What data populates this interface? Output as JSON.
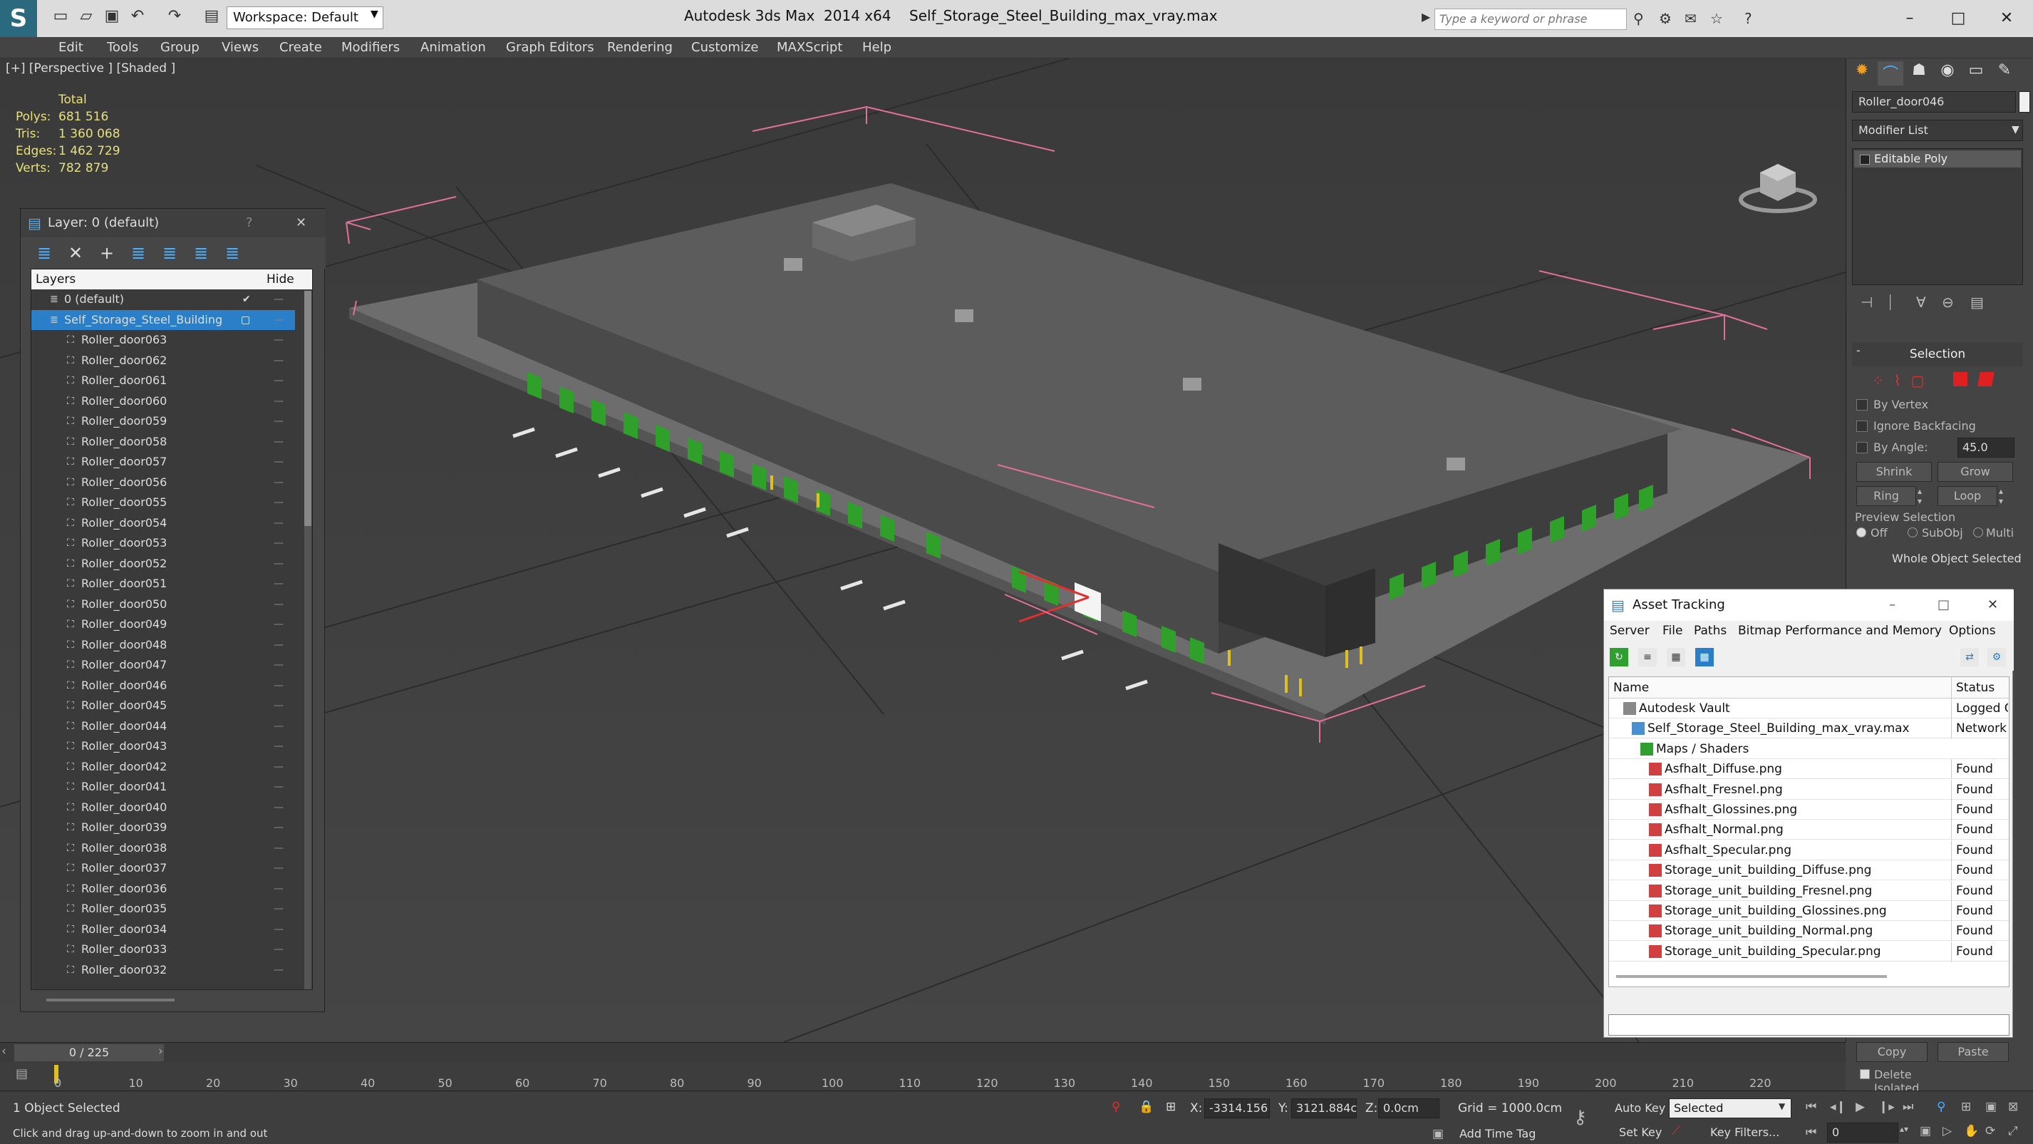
{
  "app": {
    "title": "Autodesk 3ds Max  2014 x64",
    "file": "Self_Storage_Steel_Building_max_vray.max",
    "workspace": "Workspace: Default",
    "search_placeholder": "Type a keyword or phrase"
  },
  "menu": [
    "Edit",
    "Tools",
    "Group",
    "Views",
    "Create",
    "Modifiers",
    "Animation",
    "Graph Editors",
    "Rendering",
    "Customize",
    "MAXScript",
    "Help"
  ],
  "viewport": {
    "label": "[+] [Perspective ] [Shaded ]",
    "stats": {
      "header": "Total",
      "polys_label": "Polys:",
      "polys": "681 516",
      "tris_label": "Tris:",
      "tris": "1 360 068",
      "edges_label": "Edges:",
      "edges": "1 462 729",
      "verts_label": "Verts:",
      "verts": "782 879"
    }
  },
  "layer_panel": {
    "title": "Layer: 0 (default)",
    "help": "?",
    "col_layers": "Layers",
    "col_hide": "Hide",
    "rows": [
      {
        "name": "0 (default)",
        "level": 0
      },
      {
        "name": "Self_Storage_Steel_Building",
        "level": 0,
        "selected": true
      },
      {
        "name": "Roller_door063",
        "level": 1
      },
      {
        "name": "Roller_door062",
        "level": 1
      },
      {
        "name": "Roller_door061",
        "level": 1
      },
      {
        "name": "Roller_door060",
        "level": 1
      },
      {
        "name": "Roller_door059",
        "level": 1
      },
      {
        "name": "Roller_door058",
        "level": 1
      },
      {
        "name": "Roller_door057",
        "level": 1
      },
      {
        "name": "Roller_door056",
        "level": 1
      },
      {
        "name": "Roller_door055",
        "level": 1
      },
      {
        "name": "Roller_door054",
        "level": 1
      },
      {
        "name": "Roller_door053",
        "level": 1
      },
      {
        "name": "Roller_door052",
        "level": 1
      },
      {
        "name": "Roller_door051",
        "level": 1
      },
      {
        "name": "Roller_door050",
        "level": 1
      },
      {
        "name": "Roller_door049",
        "level": 1
      },
      {
        "name": "Roller_door048",
        "level": 1
      },
      {
        "name": "Roller_door047",
        "level": 1
      },
      {
        "name": "Roller_door046",
        "level": 1
      },
      {
        "name": "Roller_door045",
        "level": 1
      },
      {
        "name": "Roller_door044",
        "level": 1
      },
      {
        "name": "Roller_door043",
        "level": 1
      },
      {
        "name": "Roller_door042",
        "level": 1
      },
      {
        "name": "Roller_door041",
        "level": 1
      },
      {
        "name": "Roller_door040",
        "level": 1
      },
      {
        "name": "Roller_door039",
        "level": 1
      },
      {
        "name": "Roller_door038",
        "level": 1
      },
      {
        "name": "Roller_door037",
        "level": 1
      },
      {
        "name": "Roller_door036",
        "level": 1
      },
      {
        "name": "Roller_door035",
        "level": 1
      },
      {
        "name": "Roller_door034",
        "level": 1
      },
      {
        "name": "Roller_door033",
        "level": 1
      },
      {
        "name": "Roller_door032",
        "level": 1
      }
    ]
  },
  "command_panel": {
    "object_name": "Roller_door046",
    "modifier_list": "Modifier List",
    "stack_item": "Editable Poly",
    "selection_title": "Selection",
    "by_vertex": "By Vertex",
    "ignore_backfacing": "Ignore Backfacing",
    "by_angle": "By Angle:",
    "by_angle_value": "45.0",
    "shrink": "Shrink",
    "grow": "Grow",
    "ring": "Ring",
    "loop": "Loop",
    "preview_selection": "Preview Selection",
    "off": "Off",
    "subobj": "SubObj",
    "multi": "Multi",
    "whole_object": "Whole Object Selected",
    "copy": "Copy",
    "paste": "Paste",
    "delete_isolated": "Delete Isolated Vertices"
  },
  "asset_tracking": {
    "title": "Asset Tracking",
    "menu": [
      "Server",
      "File",
      "Paths",
      "Bitmap Performance and Memory",
      "Options"
    ],
    "col_name": "Name",
    "col_status": "Status",
    "rows": [
      {
        "name": "Autodesk Vault",
        "status": "Logged O",
        "indent": 1,
        "icon": "vault"
      },
      {
        "name": "Self_Storage_Steel_Building_max_vray.max",
        "status": "Network F",
        "indent": 2,
        "icon": "max"
      },
      {
        "name": "Maps / Shaders",
        "status": "",
        "indent": 3,
        "icon": "folder"
      },
      {
        "name": "Asfhalt_Diffuse.png",
        "status": "Found",
        "indent": 4,
        "icon": "png"
      },
      {
        "name": "Asfhalt_Fresnel.png",
        "status": "Found",
        "indent": 4,
        "icon": "png"
      },
      {
        "name": "Asfhalt_Glossines.png",
        "status": "Found",
        "indent": 4,
        "icon": "png"
      },
      {
        "name": "Asfhalt_Normal.png",
        "status": "Found",
        "indent": 4,
        "icon": "png"
      },
      {
        "name": "Asfhalt_Specular.png",
        "status": "Found",
        "indent": 4,
        "icon": "png"
      },
      {
        "name": "Storage_unit_building_Diffuse.png",
        "status": "Found",
        "indent": 4,
        "icon": "png"
      },
      {
        "name": "Storage_unit_building_Fresnel.png",
        "status": "Found",
        "indent": 4,
        "icon": "png"
      },
      {
        "name": "Storage_unit_building_Glossines.png",
        "status": "Found",
        "indent": 4,
        "icon": "png"
      },
      {
        "name": "Storage_unit_building_Normal.png",
        "status": "Found",
        "indent": 4,
        "icon": "png"
      },
      {
        "name": "Storage_unit_building_Specular.png",
        "status": "Found",
        "indent": 4,
        "icon": "png"
      }
    ]
  },
  "timeline": {
    "frame_counter": "0 / 225",
    "ticks": [
      "0",
      "10",
      "20",
      "30",
      "40",
      "50",
      "60",
      "70",
      "80",
      "90",
      "100",
      "110",
      "120",
      "130",
      "140",
      "150",
      "160",
      "170",
      "180",
      "190",
      "200",
      "210",
      "220"
    ]
  },
  "status": {
    "selected": "1 Object Selected",
    "prompt": "Click and drag up-and-down to zoom in and out",
    "x_label": "X:",
    "x_value": "-3314.156",
    "y_label": "Y:",
    "y_value": "3121.884c",
    "z_label": "Z:",
    "z_value": "0.0cm",
    "grid": "Grid = 1000.0cm",
    "add_time_tag": "Add Time Tag",
    "auto_key": "Auto Key",
    "auto_key_mode": "Selected",
    "set_key": "Set Key",
    "key_filters": "Key Filters...",
    "frame": "0"
  },
  "colors": {
    "selection_blue": "#2a7fc8",
    "stats_yellow": "#e8e07a",
    "door_green": "#2fa02a",
    "bbox_pink": "#e0709a"
  }
}
